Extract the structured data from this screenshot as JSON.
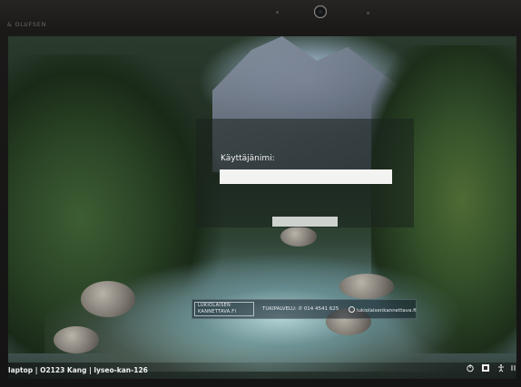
{
  "bezel": {
    "brand": "& OLUFSEN"
  },
  "login": {
    "username_label": "Käyttäjänimi:",
    "username_value": "",
    "submit_label": ""
  },
  "footer": {
    "logo_line1": "LUKIOLAISEN",
    "logo_line2": "KANNETTAVA.FI",
    "support_text": "TUKIPALVELU: ✆ 014 4541 625",
    "web_link": "lukiolaisenkannettava.fi"
  },
  "status_bar": {
    "hostname": "laptop | O2123 Kang | lyseo-kan-126"
  },
  "tray_icons": [
    "power-icon",
    "network-icon",
    "accessibility-icon",
    "language-icon"
  ],
  "colors": {
    "input_background": "#f3f3f1",
    "panel_overlay": "#19231e",
    "text_light": "#f2f2f2"
  }
}
